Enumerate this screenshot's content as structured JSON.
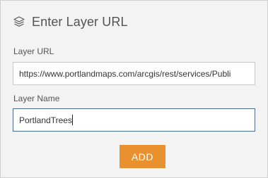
{
  "header": {
    "icon": "layers-icon",
    "title": "Enter Layer URL"
  },
  "fields": {
    "url": {
      "label": "Layer URL",
      "value": "https://www.portlandmaps.com/arcgis/rest/services/Publi"
    },
    "name": {
      "label": "Layer Name",
      "value": "PortlandTrees"
    }
  },
  "actions": {
    "add_label": "ADD"
  },
  "colors": {
    "panel_background": "#f3f3f3",
    "accent_button": "#e8912e",
    "focused_border": "#4a6d8e"
  }
}
